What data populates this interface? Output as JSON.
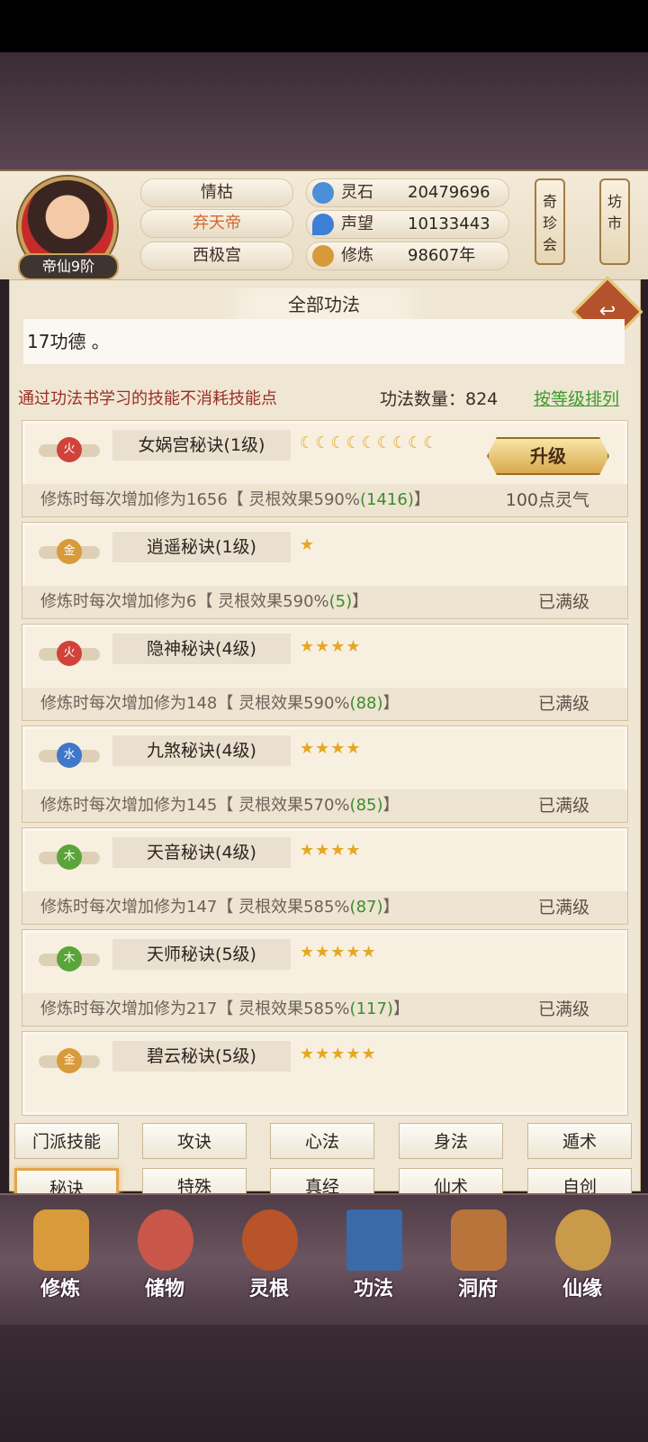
{
  "player": {
    "rank": "帝仙9阶",
    "name": "情枯",
    "title": "弃天帝",
    "sect": "西极宫"
  },
  "resources": [
    {
      "label": "灵石",
      "value": "20479696",
      "icon": "spirit-stone-icon",
      "color": "#4a8fd8"
    },
    {
      "label": "声望",
      "value": "10133443",
      "icon": "prestige-icon",
      "color": "#3b7fd6"
    },
    {
      "label": "修炼",
      "value": "98607年",
      "icon": "meditation-icon",
      "color": "#d69a3a"
    }
  ],
  "side_tags": {
    "treasure": "奇珍会",
    "market": "坊市"
  },
  "panel": {
    "title": "全部功法",
    "notice": "17功德 。",
    "hint": "通过功法书学习的技能不消耗技能点",
    "count_label": "功法数量：824",
    "sort_label": "按等级排列"
  },
  "skills": [
    {
      "element": "火",
      "element_color": "#d0433a",
      "name": "女娲宫秘诀(1级)",
      "rating": "☾☾☾☾☾☾☾☾☾",
      "desc_pre": "修炼时每次增加修为1656【 灵根效果590%",
      "desc_green": "(1416)",
      "desc_post": "】",
      "status": "100点灵气",
      "action": "升级"
    },
    {
      "element": "金",
      "element_color": "#d89a3a",
      "name": "逍遥秘诀(1级)",
      "rating": "★",
      "desc_pre": "修炼时每次增加修为6【 灵根效果590%",
      "desc_green": "(5)",
      "desc_post": "】",
      "status": "已满级"
    },
    {
      "element": "火",
      "element_color": "#d0433a",
      "name": "隐神秘诀(4级)",
      "rating": "★★★★",
      "desc_pre": "修炼时每次增加修为148【 灵根效果590%",
      "desc_green": "(88)",
      "desc_post": "】",
      "status": "已满级"
    },
    {
      "element": "水",
      "element_color": "#3f78c8",
      "name": "九煞秘诀(4级)",
      "rating": "★★★★",
      "desc_pre": "修炼时每次增加修为145【 灵根效果570%",
      "desc_green": "(85)",
      "desc_post": "】",
      "status": "已满级"
    },
    {
      "element": "木",
      "element_color": "#5aa53a",
      "name": "天音秘诀(4级)",
      "rating": "★★★★",
      "desc_pre": "修炼时每次增加修为147【 灵根效果585%",
      "desc_green": "(87)",
      "desc_post": "】",
      "status": "已满级"
    },
    {
      "element": "木",
      "element_color": "#5aa53a",
      "name": "天师秘诀(5级)",
      "rating": "★★★★★",
      "desc_pre": "修炼时每次增加修为217【 灵根效果585%",
      "desc_green": "(117)",
      "desc_post": "】",
      "status": "已满级"
    },
    {
      "element": "金",
      "element_color": "#d89a3a",
      "name": "碧云秘诀(5级)",
      "rating": "★★★★★",
      "desc_pre": "",
      "desc_green": "",
      "desc_post": "",
      "status": ""
    }
  ],
  "tabs": [
    "门派技能",
    "攻诀",
    "心法",
    "身法",
    "遁术",
    "秘诀",
    "特殊",
    "真经",
    "仙术",
    "自创"
  ],
  "active_tab": "秘诀",
  "bottom_nav": [
    {
      "label": "修炼",
      "icon": "cultivate-icon",
      "color": "#d89a3a"
    },
    {
      "label": "储物",
      "icon": "storage-bag-icon",
      "color": "#c8574a"
    },
    {
      "label": "灵根",
      "icon": "spirit-root-icon",
      "color": "#b8542a"
    },
    {
      "label": "功法",
      "icon": "technique-book-icon",
      "color": "#3a6aa8"
    },
    {
      "label": "洞府",
      "icon": "cave-dwelling-icon",
      "color": "#b8743a"
    },
    {
      "label": "仙缘",
      "icon": "immortal-fate-icon",
      "color": "#c89a4a"
    }
  ]
}
